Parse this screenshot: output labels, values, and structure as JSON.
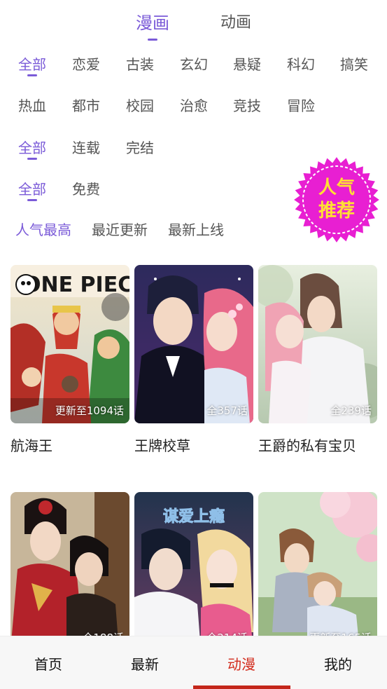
{
  "top_tabs": [
    {
      "label": "漫画",
      "active": true
    },
    {
      "label": "动画",
      "active": false
    }
  ],
  "genres_row1": [
    "全部",
    "恋爱",
    "古装",
    "玄幻",
    "悬疑",
    "科幻",
    "搞笑"
  ],
  "genres_row2": [
    "热血",
    "都市",
    "校园",
    "治愈",
    "竞技",
    "冒险"
  ],
  "status_filters": [
    "全部",
    "连载",
    "完结"
  ],
  "price_filters": [
    "全部",
    "免费"
  ],
  "sort_options": [
    "人气最高",
    "最近更新",
    "最新上线"
  ],
  "badge": {
    "line1": "人气",
    "line2": "推荐",
    "fill": "#e81fd2",
    "text_color": "#ffe033"
  },
  "comics": [
    {
      "title": "航海王",
      "progress": "更新至1094话"
    },
    {
      "title": "王牌校草",
      "progress": "全357话"
    },
    {
      "title": "王爵的私有宝贝",
      "progress": "全239话"
    },
    {
      "title": "",
      "progress": "全188话"
    },
    {
      "title": "",
      "progress": "全214话"
    },
    {
      "title": "",
      "progress": "更新至165话"
    }
  ],
  "cover_art_text": {
    "comic5": "谋爱上瘾"
  },
  "bottom_nav": [
    {
      "label": "首页",
      "active": false
    },
    {
      "label": "最新",
      "active": false
    },
    {
      "label": "动漫",
      "active": true
    },
    {
      "label": "我的",
      "active": false
    }
  ],
  "colors": {
    "accent": "#7b5bd8",
    "nav_active": "#d22b1c"
  }
}
